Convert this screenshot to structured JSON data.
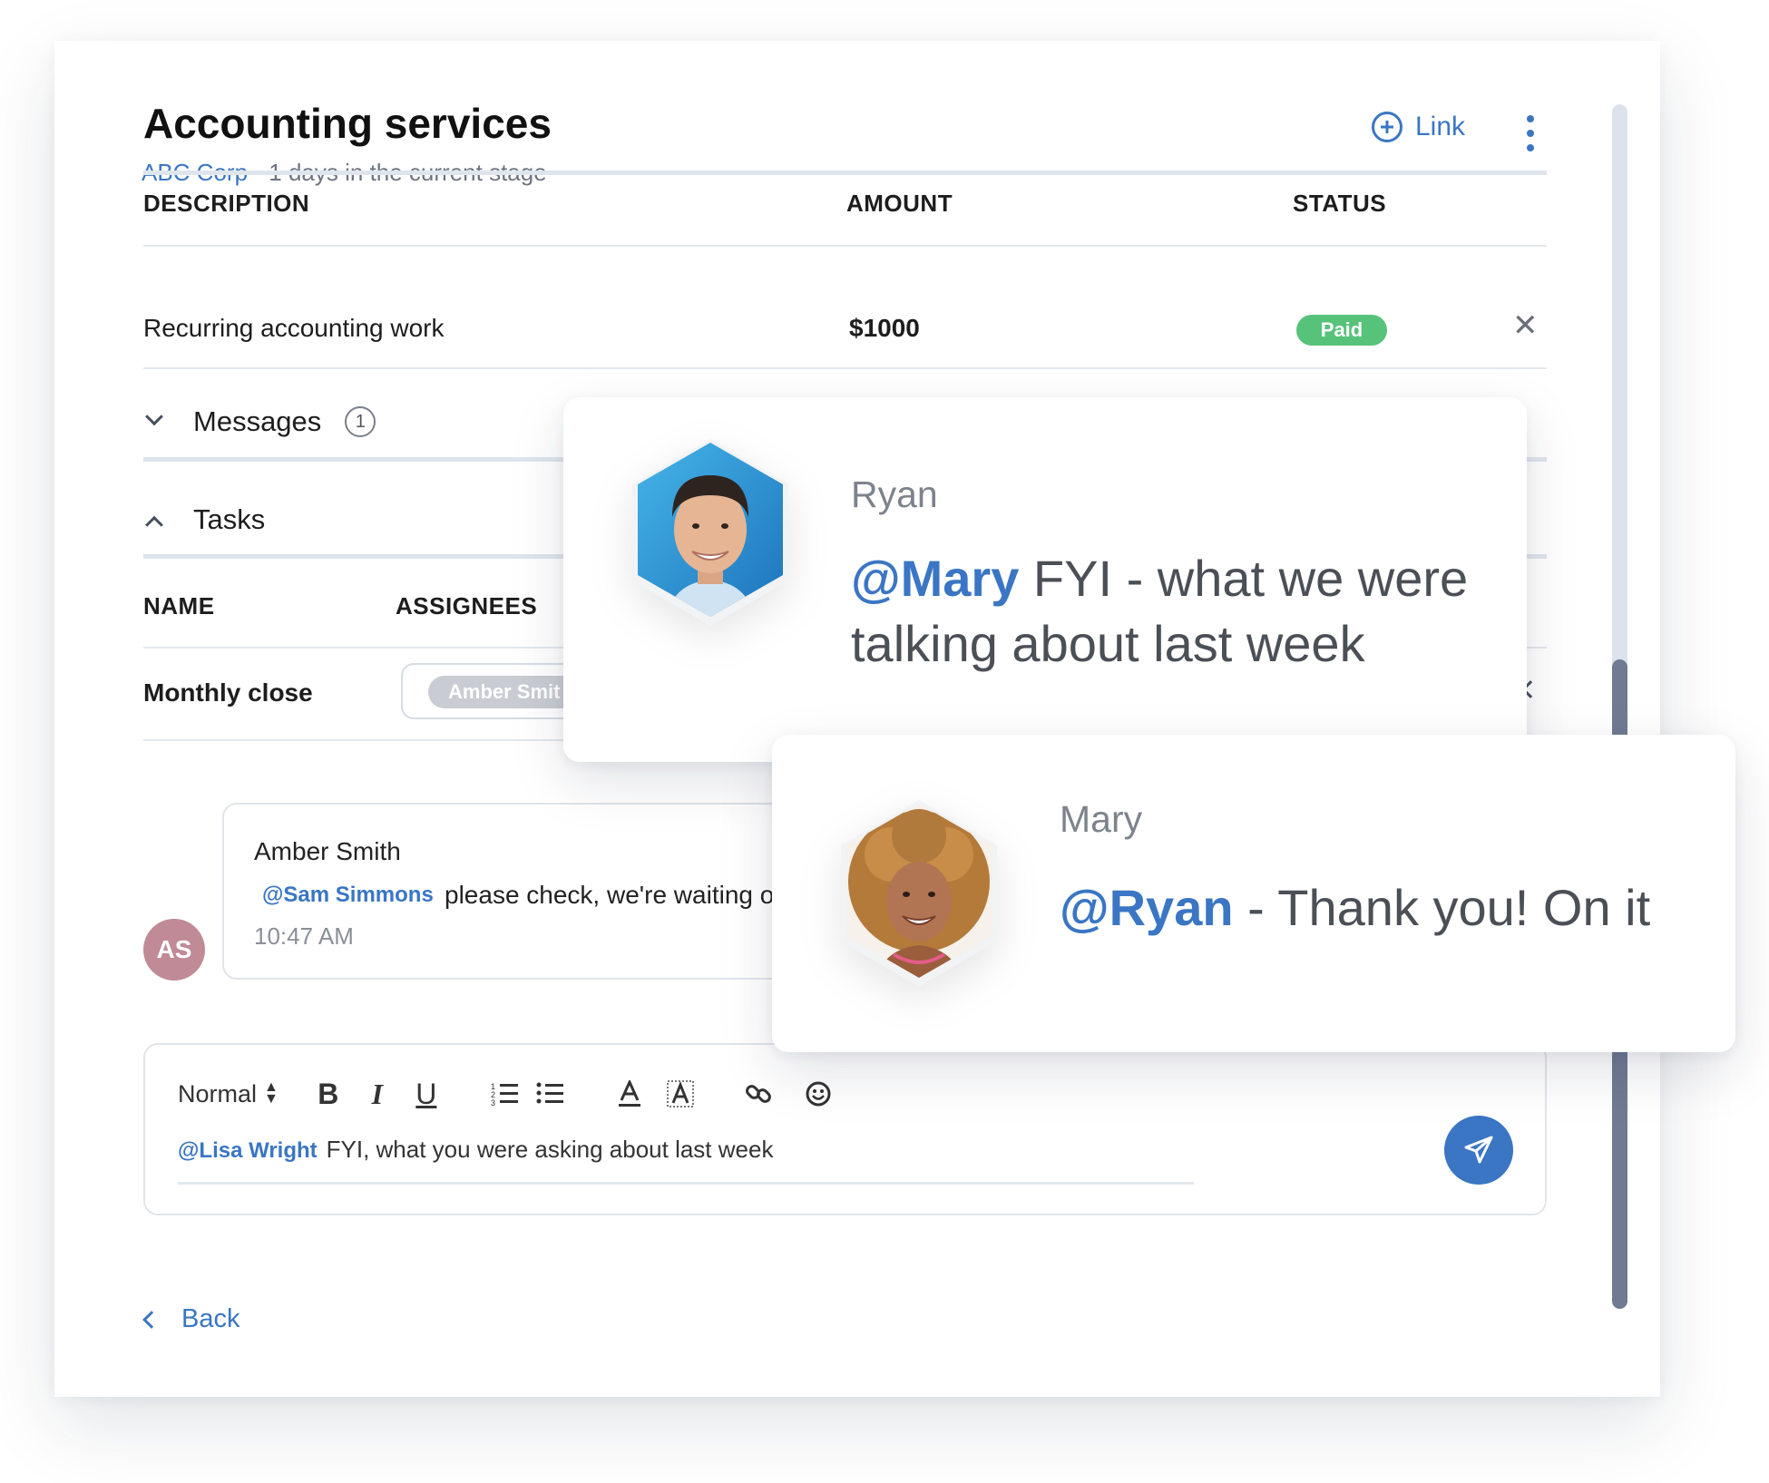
{
  "header": {
    "title": "Accounting services",
    "company": "ABC Corp",
    "stage_info": "1 days in the current stage",
    "link_label": "Link"
  },
  "table": {
    "columns": [
      "DESCRIPTION",
      "AMOUNT",
      "STATUS"
    ],
    "rows": [
      {
        "description": "Recurring accounting work",
        "amount": "$1000",
        "status": "Paid"
      }
    ]
  },
  "sections": {
    "messages_label": "Messages",
    "messages_count": "1",
    "tasks_label": "Tasks"
  },
  "tasks": {
    "columns": [
      "NAME",
      "ASSIGNEES"
    ],
    "rows": [
      {
        "name": "Monthly close",
        "assignee": "Amber Smit"
      }
    ]
  },
  "comment": {
    "initials": "AS",
    "author": "Amber Smith",
    "mention": "@Sam Simmons",
    "text": "please check, we're waiting o",
    "time": "10:47 AM"
  },
  "editor": {
    "format_label": "Normal",
    "mention": "@Lisa Wright",
    "text": "FYI, what you were asking about last week",
    "tool_icons": [
      "bold-icon",
      "italic-icon",
      "underline-icon",
      "ordered-list-icon",
      "bullet-list-icon",
      "text-color-icon",
      "highlight-icon",
      "link-icon",
      "emoji-icon"
    ]
  },
  "footer": {
    "back_label": "Back"
  },
  "bubbles": {
    "ryan": {
      "name": "Ryan",
      "mention": "@Mary",
      "text_line1": " FYI - what we were",
      "text_line2": "talking about last week"
    },
    "mary": {
      "name": "Mary",
      "mention": "@Ryan",
      "text": " - Thank you! On it"
    }
  },
  "colors": {
    "accent": "#3a76c4",
    "paid": "#57c27a",
    "avatar_as": "#c18a97",
    "scroll_thumb": "#6f7b93"
  }
}
